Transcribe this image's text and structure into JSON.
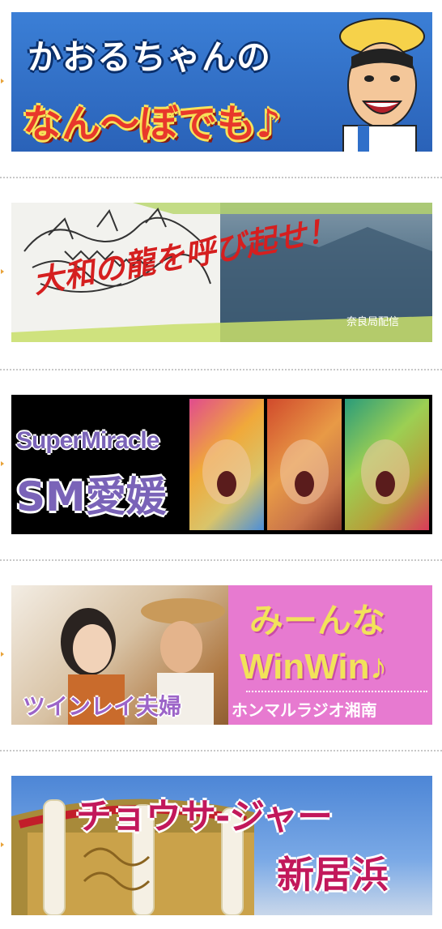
{
  "banners": [
    {
      "id": "kaoru",
      "line1": "かおるちゃんの",
      "line2": "なん～ぼでも♪",
      "colors": {
        "bg": "#2f6fc9",
        "line1": "#ffffff",
        "line1_stroke": "#0a2f6b",
        "line2": "#e8382b",
        "line2_stroke": "#f7e35a"
      }
    },
    {
      "id": "yamato",
      "title": "大和の龍を呼び起せ！",
      "credit": "奈良局配信",
      "colors": {
        "left_bg": "#f2f2ee",
        "right_bg": "#3f5f78",
        "title": "#d51f1f",
        "credit": "#ffffff"
      }
    },
    {
      "id": "sm-ehime",
      "line1": "SuperMiracle",
      "line2": "SM愛媛",
      "colors": {
        "bg": "#000000",
        "text": "#7a63b8",
        "text_stroke": "#ffffff"
      }
    },
    {
      "id": "winwin",
      "left_caption": "ツインレイ夫婦",
      "line1": "みーんな",
      "line2": "WinWin♪",
      "footer": "ホンマルラジオ湘南",
      "colors": {
        "left_bg": "#e9d9c6",
        "right_bg": "#e77ad0",
        "heading": "#f2e25a",
        "left_caption": "#9c64c8",
        "footer": "#ffffff"
      }
    },
    {
      "id": "chousa",
      "line1": "チョウサ-ジャー",
      "line2": "新居浜",
      "colors": {
        "sky": "#5c8fd9",
        "text": "#c2185b",
        "text_stroke": "#ffffff"
      }
    }
  ]
}
